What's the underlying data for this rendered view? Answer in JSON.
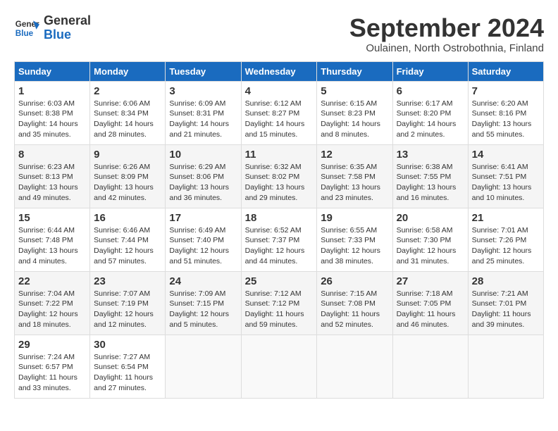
{
  "logo": {
    "line1": "General",
    "line2": "Blue"
  },
  "title": "September 2024",
  "subtitle": "Oulainen, North Ostrobothnia, Finland",
  "weekdays": [
    "Sunday",
    "Monday",
    "Tuesday",
    "Wednesday",
    "Thursday",
    "Friday",
    "Saturday"
  ],
  "weeks": [
    [
      {
        "day": "1",
        "sunrise": "Sunrise: 6:03 AM",
        "sunset": "Sunset: 8:38 PM",
        "daylight": "Daylight: 14 hours and 35 minutes."
      },
      {
        "day": "2",
        "sunrise": "Sunrise: 6:06 AM",
        "sunset": "Sunset: 8:34 PM",
        "daylight": "Daylight: 14 hours and 28 minutes."
      },
      {
        "day": "3",
        "sunrise": "Sunrise: 6:09 AM",
        "sunset": "Sunset: 8:31 PM",
        "daylight": "Daylight: 14 hours and 21 minutes."
      },
      {
        "day": "4",
        "sunrise": "Sunrise: 6:12 AM",
        "sunset": "Sunset: 8:27 PM",
        "daylight": "Daylight: 14 hours and 15 minutes."
      },
      {
        "day": "5",
        "sunrise": "Sunrise: 6:15 AM",
        "sunset": "Sunset: 8:23 PM",
        "daylight": "Daylight: 14 hours and 8 minutes."
      },
      {
        "day": "6",
        "sunrise": "Sunrise: 6:17 AM",
        "sunset": "Sunset: 8:20 PM",
        "daylight": "Daylight: 14 hours and 2 minutes."
      },
      {
        "day": "7",
        "sunrise": "Sunrise: 6:20 AM",
        "sunset": "Sunset: 8:16 PM",
        "daylight": "Daylight: 13 hours and 55 minutes."
      }
    ],
    [
      {
        "day": "8",
        "sunrise": "Sunrise: 6:23 AM",
        "sunset": "Sunset: 8:13 PM",
        "daylight": "Daylight: 13 hours and 49 minutes."
      },
      {
        "day": "9",
        "sunrise": "Sunrise: 6:26 AM",
        "sunset": "Sunset: 8:09 PM",
        "daylight": "Daylight: 13 hours and 42 minutes."
      },
      {
        "day": "10",
        "sunrise": "Sunrise: 6:29 AM",
        "sunset": "Sunset: 8:06 PM",
        "daylight": "Daylight: 13 hours and 36 minutes."
      },
      {
        "day": "11",
        "sunrise": "Sunrise: 6:32 AM",
        "sunset": "Sunset: 8:02 PM",
        "daylight": "Daylight: 13 hours and 29 minutes."
      },
      {
        "day": "12",
        "sunrise": "Sunrise: 6:35 AM",
        "sunset": "Sunset: 7:58 PM",
        "daylight": "Daylight: 13 hours and 23 minutes."
      },
      {
        "day": "13",
        "sunrise": "Sunrise: 6:38 AM",
        "sunset": "Sunset: 7:55 PM",
        "daylight": "Daylight: 13 hours and 16 minutes."
      },
      {
        "day": "14",
        "sunrise": "Sunrise: 6:41 AM",
        "sunset": "Sunset: 7:51 PM",
        "daylight": "Daylight: 13 hours and 10 minutes."
      }
    ],
    [
      {
        "day": "15",
        "sunrise": "Sunrise: 6:44 AM",
        "sunset": "Sunset: 7:48 PM",
        "daylight": "Daylight: 13 hours and 4 minutes."
      },
      {
        "day": "16",
        "sunrise": "Sunrise: 6:46 AM",
        "sunset": "Sunset: 7:44 PM",
        "daylight": "Daylight: 12 hours and 57 minutes."
      },
      {
        "day": "17",
        "sunrise": "Sunrise: 6:49 AM",
        "sunset": "Sunset: 7:40 PM",
        "daylight": "Daylight: 12 hours and 51 minutes."
      },
      {
        "day": "18",
        "sunrise": "Sunrise: 6:52 AM",
        "sunset": "Sunset: 7:37 PM",
        "daylight": "Daylight: 12 hours and 44 minutes."
      },
      {
        "day": "19",
        "sunrise": "Sunrise: 6:55 AM",
        "sunset": "Sunset: 7:33 PM",
        "daylight": "Daylight: 12 hours and 38 minutes."
      },
      {
        "day": "20",
        "sunrise": "Sunrise: 6:58 AM",
        "sunset": "Sunset: 7:30 PM",
        "daylight": "Daylight: 12 hours and 31 minutes."
      },
      {
        "day": "21",
        "sunrise": "Sunrise: 7:01 AM",
        "sunset": "Sunset: 7:26 PM",
        "daylight": "Daylight: 12 hours and 25 minutes."
      }
    ],
    [
      {
        "day": "22",
        "sunrise": "Sunrise: 7:04 AM",
        "sunset": "Sunset: 7:22 PM",
        "daylight": "Daylight: 12 hours and 18 minutes."
      },
      {
        "day": "23",
        "sunrise": "Sunrise: 7:07 AM",
        "sunset": "Sunset: 7:19 PM",
        "daylight": "Daylight: 12 hours and 12 minutes."
      },
      {
        "day": "24",
        "sunrise": "Sunrise: 7:09 AM",
        "sunset": "Sunset: 7:15 PM",
        "daylight": "Daylight: 12 hours and 5 minutes."
      },
      {
        "day": "25",
        "sunrise": "Sunrise: 7:12 AM",
        "sunset": "Sunset: 7:12 PM",
        "daylight": "Daylight: 11 hours and 59 minutes."
      },
      {
        "day": "26",
        "sunrise": "Sunrise: 7:15 AM",
        "sunset": "Sunset: 7:08 PM",
        "daylight": "Daylight: 11 hours and 52 minutes."
      },
      {
        "day": "27",
        "sunrise": "Sunrise: 7:18 AM",
        "sunset": "Sunset: 7:05 PM",
        "daylight": "Daylight: 11 hours and 46 minutes."
      },
      {
        "day": "28",
        "sunrise": "Sunrise: 7:21 AM",
        "sunset": "Sunset: 7:01 PM",
        "daylight": "Daylight: 11 hours and 39 minutes."
      }
    ],
    [
      {
        "day": "29",
        "sunrise": "Sunrise: 7:24 AM",
        "sunset": "Sunset: 6:57 PM",
        "daylight": "Daylight: 11 hours and 33 minutes."
      },
      {
        "day": "30",
        "sunrise": "Sunrise: 7:27 AM",
        "sunset": "Sunset: 6:54 PM",
        "daylight": "Daylight: 11 hours and 27 minutes."
      },
      null,
      null,
      null,
      null,
      null
    ]
  ]
}
